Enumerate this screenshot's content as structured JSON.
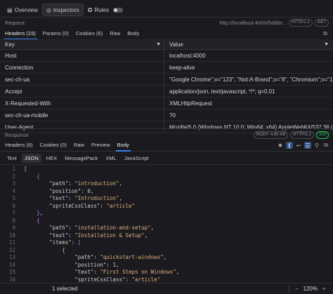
{
  "top_tabs": [
    {
      "label": "Overview",
      "icon": "chart-icon"
    },
    {
      "label": "Inspectors",
      "icon": "inspect-icon"
    },
    {
      "label": "Rules",
      "icon": "rules-icon"
    }
  ],
  "request": {
    "section_label": "Request",
    "url": "http://localhost:4000/fiddler...",
    "protocol": "HTTP/1.1",
    "method": "GET",
    "tabs": [
      "Headers (15)",
      "Params (0)",
      "Cookies (6)",
      "Raw",
      "Body"
    ],
    "grid": {
      "columns": [
        "Key",
        "Value"
      ],
      "rows": [
        {
          "key": "Host",
          "value": "localhost:4000"
        },
        {
          "key": "Connection",
          "value": "keep-alive"
        },
        {
          "key": "sec-ch-ua",
          "value": "\"Google Chrome\";v=\"123\", \"Not:A-Brand\";v=\"8\", \"Chromium\";v=\"123\""
        },
        {
          "key": "Accept",
          "value": "application/json, text/javascript, */*; q=0.01"
        },
        {
          "key": "X-Requested-With",
          "value": "XMLHttpRequest"
        },
        {
          "key": "sec-ch-ua-mobile",
          "value": "?0"
        },
        {
          "key": "User-Agent",
          "value": "Mozilla/5.0 (Windows NT 10.0; Win64; x64) AppleWebKit/537.36 (KHT..."
        }
      ]
    }
  },
  "response": {
    "section_label": "Response",
    "body_size": "BODY: 4.85 KB",
    "protocol": "HTTP/1.1",
    "status_code": "200",
    "tabs": [
      "Headers (8)",
      "Cookies (0)",
      "Raw",
      "Preview",
      "Body"
    ],
    "format_tabs": [
      "Text",
      "JSON",
      "HEX",
      "MessagePack",
      "XML",
      "JavaScript"
    ],
    "code_lines": [
      {
        "n": "1",
        "text": "["
      },
      {
        "n": "2",
        "text": "    {"
      },
      {
        "n": "3",
        "text": "        \"path\": \"introduction\","
      },
      {
        "n": "4",
        "text": "        \"position\": 0,"
      },
      {
        "n": "5",
        "text": "        \"text\": \"Introduction\","
      },
      {
        "n": "6",
        "text": "        \"spriteCssClass\": \"article\""
      },
      {
        "n": "7",
        "text": "    },"
      },
      {
        "n": "8",
        "text": "    {"
      },
      {
        "n": "9",
        "text": "        \"path\": \"installation-and-setup\","
      },
      {
        "n": "10",
        "text": "        \"text\": \"Installation & Setup\","
      },
      {
        "n": "11",
        "text": "        \"items\": ["
      },
      {
        "n": "12",
        "text": "            {"
      },
      {
        "n": "13",
        "text": "                \"path\": \"quickstart-windows\","
      },
      {
        "n": "14",
        "text": "                \"position\": 1,"
      },
      {
        "n": "15",
        "text": "                \"text\": \"First Steps on Windows\","
      },
      {
        "n": "16",
        "text": "                \"spriteCssClass\": \"article\""
      }
    ]
  },
  "status_bar": {
    "selection": "1 selected",
    "zoom": "120%"
  },
  "colors": {
    "accent": "#3b82f6",
    "status_ok": "#22c55e"
  }
}
